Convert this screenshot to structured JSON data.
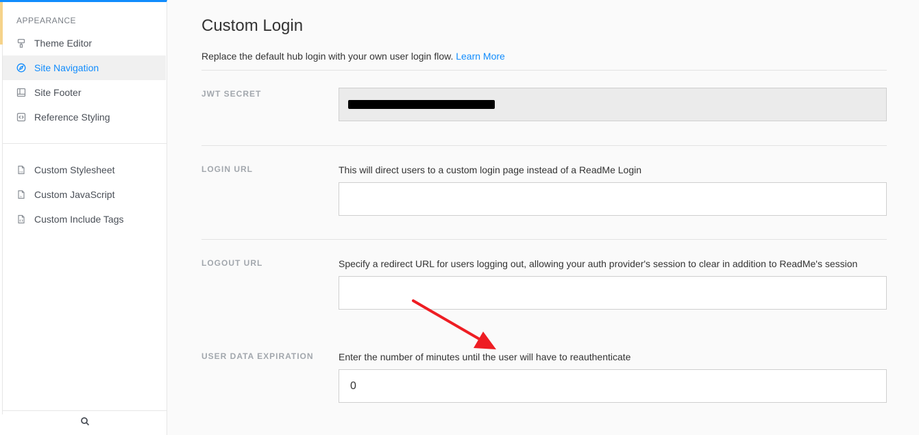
{
  "sidebar": {
    "section_heading": "APPEARANCE",
    "items": [
      {
        "label": "Theme Editor",
        "icon": "paint-roller-icon",
        "active": false
      },
      {
        "label": "Site Navigation",
        "icon": "compass-icon",
        "active": true
      },
      {
        "label": "Site Footer",
        "icon": "layout-icon",
        "active": false
      },
      {
        "label": "Reference Styling",
        "icon": "code-box-icon",
        "active": false
      }
    ],
    "custom_items": [
      {
        "label": "Custom Stylesheet",
        "icon": "css-file-icon"
      },
      {
        "label": "Custom JavaScript",
        "icon": "js-file-icon"
      },
      {
        "label": "Custom Include Tags",
        "icon": "html-file-icon"
      }
    ],
    "search_icon": "search-icon"
  },
  "main": {
    "title": "Custom Login",
    "intro_text": "Replace the default hub login with your own user login flow.",
    "learn_more": "Learn More",
    "fields": {
      "jwt_secret": {
        "label": "JWT SECRET",
        "value": ""
      },
      "login_url": {
        "label": "LOGIN URL",
        "help": "This will direct users to a custom login page instead of a ReadMe Login",
        "value": ""
      },
      "logout_url": {
        "label": "LOGOUT URL",
        "help": "Specify a redirect URL for users logging out, allowing your auth provider's session to clear in addition to ReadMe's session",
        "value": ""
      },
      "user_data_expiration": {
        "label": "USER DATA EXPIRATION",
        "help": "Enter the number of minutes until the user will have to reauthenticate",
        "value": "0"
      }
    }
  },
  "colors": {
    "accent": "#118cfd",
    "annotation_arrow": "#ee1d23"
  }
}
